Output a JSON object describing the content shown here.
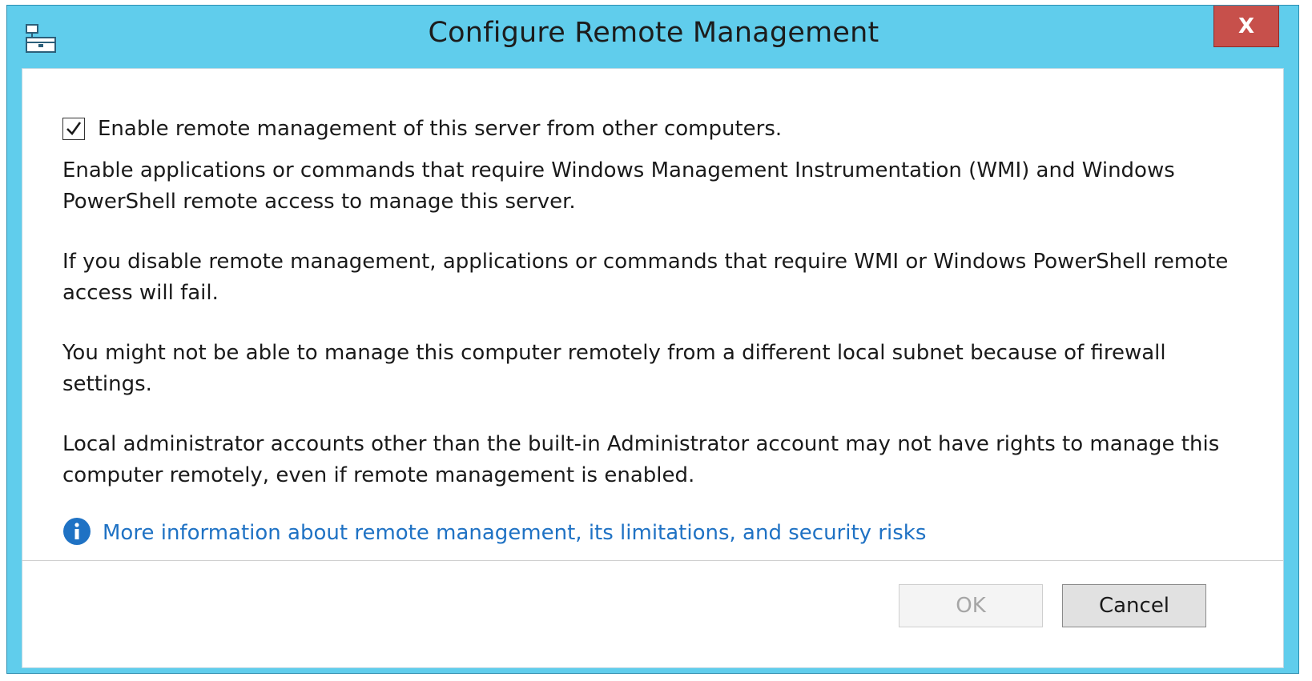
{
  "window": {
    "title": "Configure Remote Management",
    "close_label": "X",
    "title_icon": "server-manager-icon"
  },
  "content": {
    "checkbox": {
      "label": "Enable remote management of this server from other computers.",
      "checked": true
    },
    "paragraphs": [
      "Enable applications or commands that require Windows Management Instrumentation (WMI) and Windows PowerShell remote access to manage this server.",
      "If you disable remote management, applications or commands that require WMI or Windows PowerShell remote access will fail.",
      "You might not be able to manage this computer remotely from a different local subnet because of firewall settings.",
      "Local administrator accounts other than the built-in Administrator account may not have rights to manage this computer remotely, even if remote management is enabled."
    ],
    "info_link": {
      "icon": "info-icon",
      "text": "More information about remote management, its limitations, and security risks"
    }
  },
  "buttons": {
    "ok_label": "OK",
    "ok_enabled": false,
    "cancel_label": "Cancel"
  },
  "colors": {
    "title_bar": "#60cdec",
    "close_button": "#c7504b",
    "link": "#1f72c4"
  }
}
